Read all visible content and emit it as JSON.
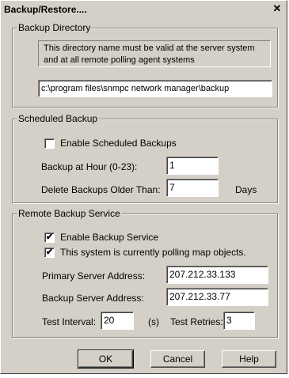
{
  "window": {
    "title": "Backup/Restore....",
    "close_glyph": "✕"
  },
  "backup_directory": {
    "legend": "Backup Directory",
    "note": "This directory name must be valid at the server system and at all remote polling agent systems",
    "path": "c:\\program files\\snmpc network manager\\backup"
  },
  "scheduled_backup": {
    "legend": "Scheduled Backup",
    "enable_label": "Enable Scheduled Backups",
    "enable_checked": false,
    "hour_label": "Backup at Hour (0-23):",
    "hour_value": "1",
    "delete_label": "Delete Backups Older Than:",
    "delete_value": "7",
    "days_label": "Days"
  },
  "remote_backup": {
    "legend": "Remote Backup Service",
    "enable_label": "Enable Backup Service",
    "enable_checked": true,
    "polling_label": "This system is currently polling map objects.",
    "polling_checked": true,
    "primary_label": "Primary Server Address:",
    "primary_value": "207.212.33.133",
    "backup_label": "Backup Server Address:",
    "backup_value": "207.212.33.77",
    "interval_label": "Test Interval:",
    "interval_value": "20",
    "interval_unit": "(s)",
    "retries_label": "Test Retries:",
    "retries_value": "3"
  },
  "buttons": {
    "ok": "OK",
    "cancel": "Cancel",
    "help": "Help"
  },
  "icons": {
    "checkmark": "✔"
  }
}
